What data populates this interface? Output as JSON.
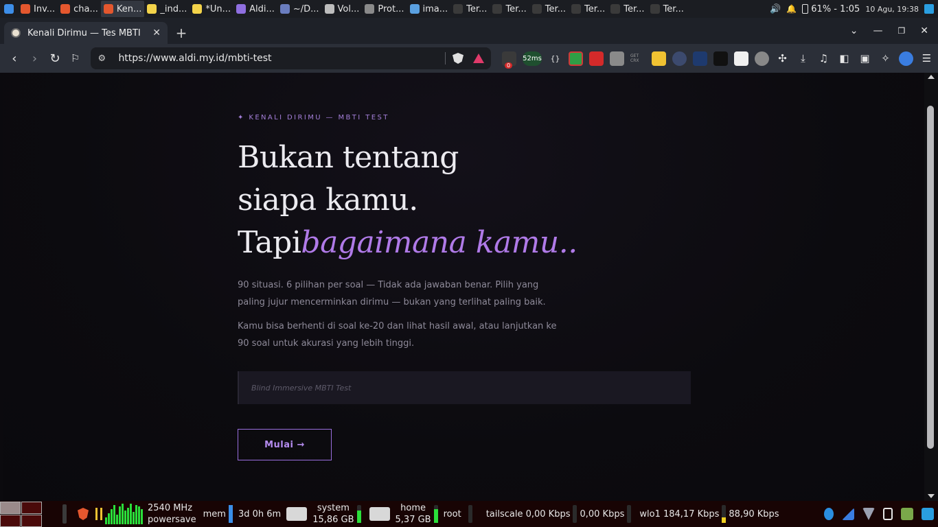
{
  "system_top": {
    "tasks": [
      {
        "label": "Inv...",
        "color": "#e4572e"
      },
      {
        "label": "cha...",
        "color": "#e4572e"
      },
      {
        "label": "Ken...",
        "color": "#e4572e",
        "active": true
      },
      {
        "label": "_ind...",
        "color": "#f3d34a"
      },
      {
        "label": "*Un...",
        "color": "#f3d34a"
      },
      {
        "label": "Aldi...",
        "color": "#8f6fe0"
      },
      {
        "label": "~/D...",
        "color": "#6a7dbf"
      },
      {
        "label": "Vol...",
        "color": "#bdbdbd"
      },
      {
        "label": "Prot...",
        "color": "#8a8a8a"
      },
      {
        "label": "ima...",
        "color": "#5aa0e0"
      },
      {
        "label": "Ter...",
        "color": "#3a3a3a"
      },
      {
        "label": "Ter...",
        "color": "#3a3a3a"
      },
      {
        "label": "Ter...",
        "color": "#3a3a3a"
      },
      {
        "label": "Ter...",
        "color": "#3a3a3a"
      },
      {
        "label": "Ter...",
        "color": "#3a3a3a"
      },
      {
        "label": "Ter...",
        "color": "#3a3a3a"
      }
    ],
    "battery": "61% - 1:05",
    "clock": "10 Agu, 19:38"
  },
  "browser": {
    "tab_title": "Kenali Dirimu — Tes MBTI",
    "tab_close": "✕",
    "new_tab": "+",
    "url": "https://www.aldi.my.id/mbti-test",
    "ping_badge": "52ms",
    "ext_counter": "0",
    "ext_get_crx": "GET CRX"
  },
  "page": {
    "eyebrow": "✦ KENALI DIRIMU — MBTI TEST",
    "headline_line1": "Bukan tentang",
    "headline_line2": "siapa kamu.",
    "headline_line3_plain": "Tapi",
    "headline_line3_accent": "bagaimana kamu..",
    "lead": "90 situasi. 6 pilihan per soal — Tidak ada jawaban benar. Pilih yang paling jujur mencerminkan dirimu — bukan yang terlihat paling baik.",
    "lead2": "Kamu bisa berhenti di soal ke-20 dan lihat hasil awal, atau lanjutkan ke 90 soal untuk akurasi yang lebih tinggi.",
    "name_placeholder": "Blind Immersive MBTI Test",
    "start_label": "Mulai →"
  },
  "system_bottom": {
    "cpu_freq": "2540 MHz",
    "cpu_governor": "powersave",
    "mem_label": "mem",
    "uptime": "3d 0h 6m",
    "system_label": "system",
    "system_size": "15,86 GB",
    "home_label": "home",
    "home_size": "5,37 GB",
    "root_label": "root",
    "tailscale": "tailscale 0,00 Kbps",
    "tailscale_up": "0,00 Kbps",
    "wlo1": "wlo1 184,17 Kbps",
    "wlo1_up": "88,90 Kbps"
  },
  "colors": {
    "accent": "#b07ae8",
    "page_bg": "#0b0a0e",
    "panel_bottom": "#180404"
  }
}
